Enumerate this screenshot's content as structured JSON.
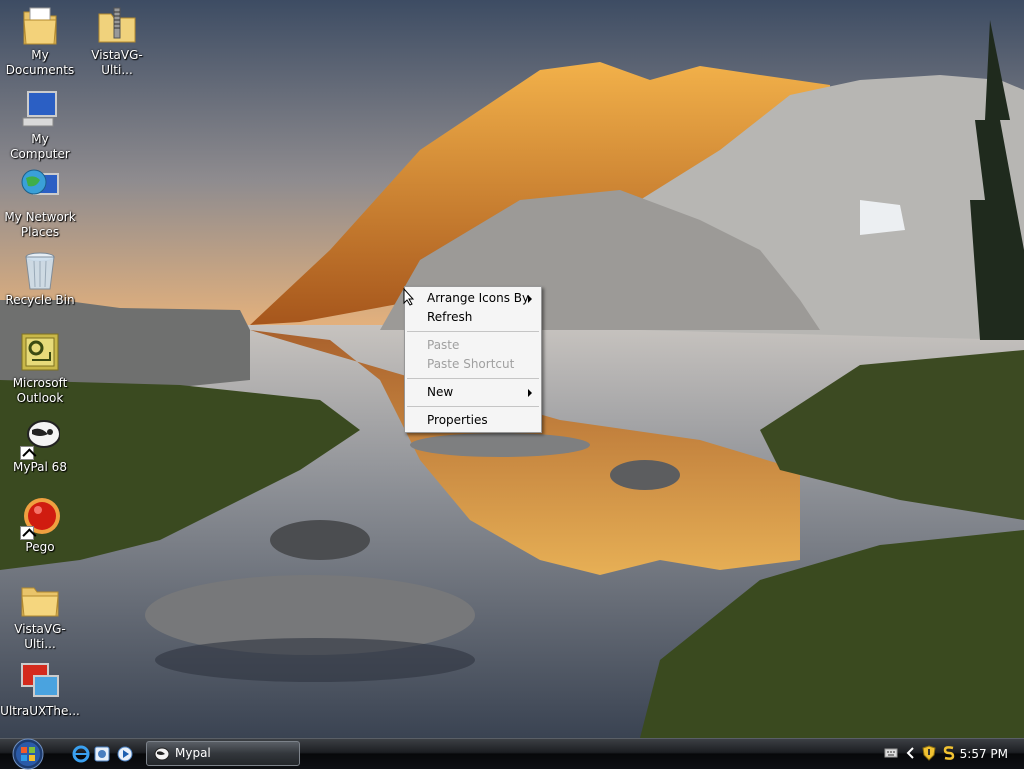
{
  "desktop": {
    "icons": [
      {
        "label": "My Documents",
        "icon": "folder-documents-icon"
      },
      {
        "label": "VistaVG-Ulti...",
        "icon": "zip-folder-icon"
      },
      {
        "label": "My Computer",
        "icon": "computer-icon"
      },
      {
        "label": "My Network Places",
        "icon": "network-globe-icon"
      },
      {
        "label": "Recycle Bin",
        "icon": "recycle-bin-icon"
      },
      {
        "label": "Microsoft Outlook",
        "icon": "outlook-icon"
      },
      {
        "label": "MyPal 68",
        "icon": "mypal-raccoon-icon"
      },
      {
        "label": "Pego",
        "icon": "pego-red-ball-icon"
      },
      {
        "label": "VistaVG-Ulti...",
        "icon": "folder-icon"
      },
      {
        "label": "UltraUXThe...",
        "icon": "display-theme-icon"
      }
    ]
  },
  "context_menu": {
    "items": [
      {
        "label": "Arrange Icons By",
        "submenu": true,
        "enabled": true
      },
      {
        "label": "Refresh",
        "submenu": false,
        "enabled": true
      },
      {
        "label": "Paste",
        "submenu": false,
        "enabled": false
      },
      {
        "label": "Paste Shortcut",
        "submenu": false,
        "enabled": false
      },
      {
        "label": "New",
        "submenu": true,
        "enabled": true
      },
      {
        "label": "Properties",
        "submenu": false,
        "enabled": true
      }
    ]
  },
  "taskbar": {
    "start_icon": "windows-start-orb-icon",
    "quick_launch": [
      "internet-explorer-icon",
      "browser-icon",
      "media-player-icon"
    ],
    "tasks": [
      {
        "label": "Mypal",
        "icon": "mypal-raccoon-icon"
      }
    ],
    "tray": [
      "keyboard-icon",
      "chevron-left-icon",
      "security-shield-icon",
      "s-app-icon"
    ],
    "clock": "5:57 PM"
  },
  "colors": {
    "menu_bg": "#f5f5f5",
    "menu_border": "#979797",
    "disabled_text": "#a0a0a0",
    "taskbar_dark": "#0e1014"
  }
}
